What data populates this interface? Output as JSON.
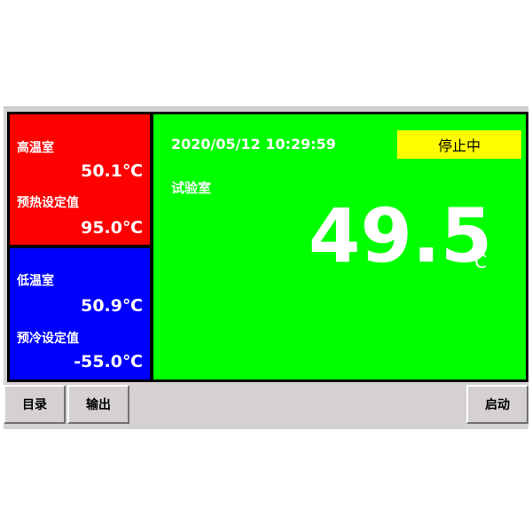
{
  "hot_chamber": {
    "label": "高温室",
    "temp": "50.1℃",
    "setpoint_label": "预热设定值",
    "setpoint": "95.0℃"
  },
  "cold_chamber": {
    "label": "低温室",
    "temp": "50.9℃",
    "setpoint_label": "预冷设定值",
    "setpoint": "-55.0℃"
  },
  "test_chamber": {
    "datetime": "2020/05/12 10:29:59",
    "status": "停止中",
    "label": "试验室",
    "temp": "49.5",
    "unit": "℃"
  },
  "toolbar": {
    "menu": "目录",
    "output": "输出",
    "start": "启动"
  },
  "colors": {
    "hot": "#ff0000",
    "cold": "#0000ff",
    "test": "#00ff00",
    "status_bg": "#ffff00"
  }
}
